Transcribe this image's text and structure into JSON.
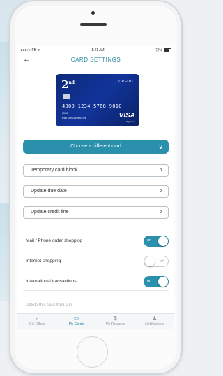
{
  "status": {
    "carrier": "●●●○○ FB",
    "wifi": "ᯤ",
    "time": "1:41 AM",
    "battery": "77%"
  },
  "nav": {
    "back": "←",
    "title": "CARD SETTINGS"
  },
  "card": {
    "brand": "2",
    "brand_sup": "nd",
    "type": "CREDIT",
    "number": "4000 1234 5768 9010",
    "expiry": "00/00",
    "holder": "PAT ANDERSON",
    "network": "VISA",
    "network_sub": "Signature"
  },
  "choose_button": {
    "label": "Choose a different card",
    "chevron": "∨"
  },
  "options": [
    {
      "label": "Temporary card block",
      "chevron": "›"
    },
    {
      "label": "Update due date",
      "chevron": "›"
    },
    {
      "label": "Update credit line",
      "chevron": "›"
    }
  ],
  "toggles": [
    {
      "label": "Mail / Phone order shopping",
      "state": "on",
      "text": "on"
    },
    {
      "label": "Internet shopping",
      "state": "off",
      "text": "off"
    },
    {
      "label": "International transactions",
      "state": "on",
      "text": "on"
    }
  ],
  "delete_label": "Delete this card from Giri",
  "tabs": [
    {
      "label": "Giri Offers",
      "icon": "➹"
    },
    {
      "label": "My Cards",
      "icon": "▭"
    },
    {
      "label": "My Rewards",
      "icon": "$"
    },
    {
      "label": "Notifications",
      "icon": "♟"
    }
  ],
  "colors": {
    "accent": "#2a90ab",
    "card": "#12349a"
  }
}
